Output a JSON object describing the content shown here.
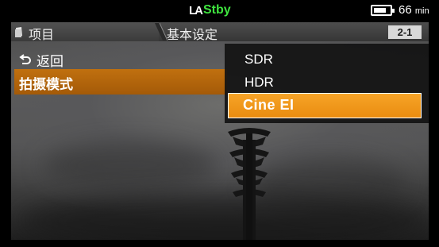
{
  "status": {
    "rec_mode_icon": "LA",
    "rec_state": "Stby",
    "battery_level": 0.8,
    "battery_value": "66",
    "battery_unit": "min"
  },
  "header": {
    "tab_items": "项目",
    "tab_basic": "基本设定",
    "page_indicator": "2-1"
  },
  "menu": {
    "back_label": "返回",
    "shoot_mode_label": "拍摄模式"
  },
  "dropdown": {
    "options": [
      "SDR",
      "HDR",
      "Cine EI"
    ],
    "selected": "Cine EI"
  },
  "colors": {
    "accent": "#f3a020",
    "menu_highlight": "#b36609",
    "standby_green": "#3fe43f"
  }
}
